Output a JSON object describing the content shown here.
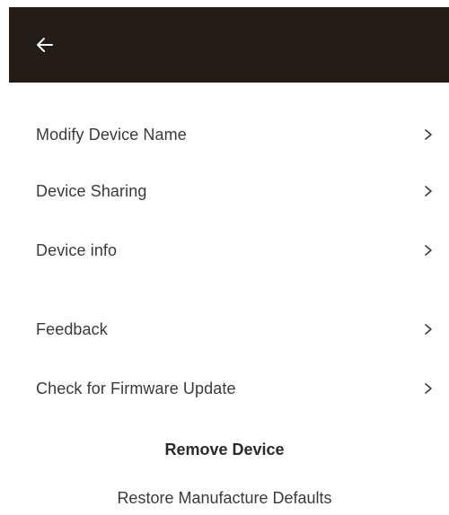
{
  "header": {
    "back_icon": "arrow-left-icon",
    "background": "#231d1a"
  },
  "menu": {
    "items": [
      {
        "label": "Modify Device Name",
        "icon": "chevron-right-icon"
      },
      {
        "label": "Device Sharing",
        "icon": "chevron-right-icon"
      },
      {
        "label": "Device info",
        "icon": "chevron-right-icon"
      },
      {
        "label": "Feedback",
        "icon": "chevron-right-icon"
      },
      {
        "label": "Check for Firmware Update",
        "icon": "chevron-right-icon"
      }
    ]
  },
  "actions": {
    "remove_label": "Remove Device",
    "restore_label": "Restore Manufacture Defaults"
  }
}
